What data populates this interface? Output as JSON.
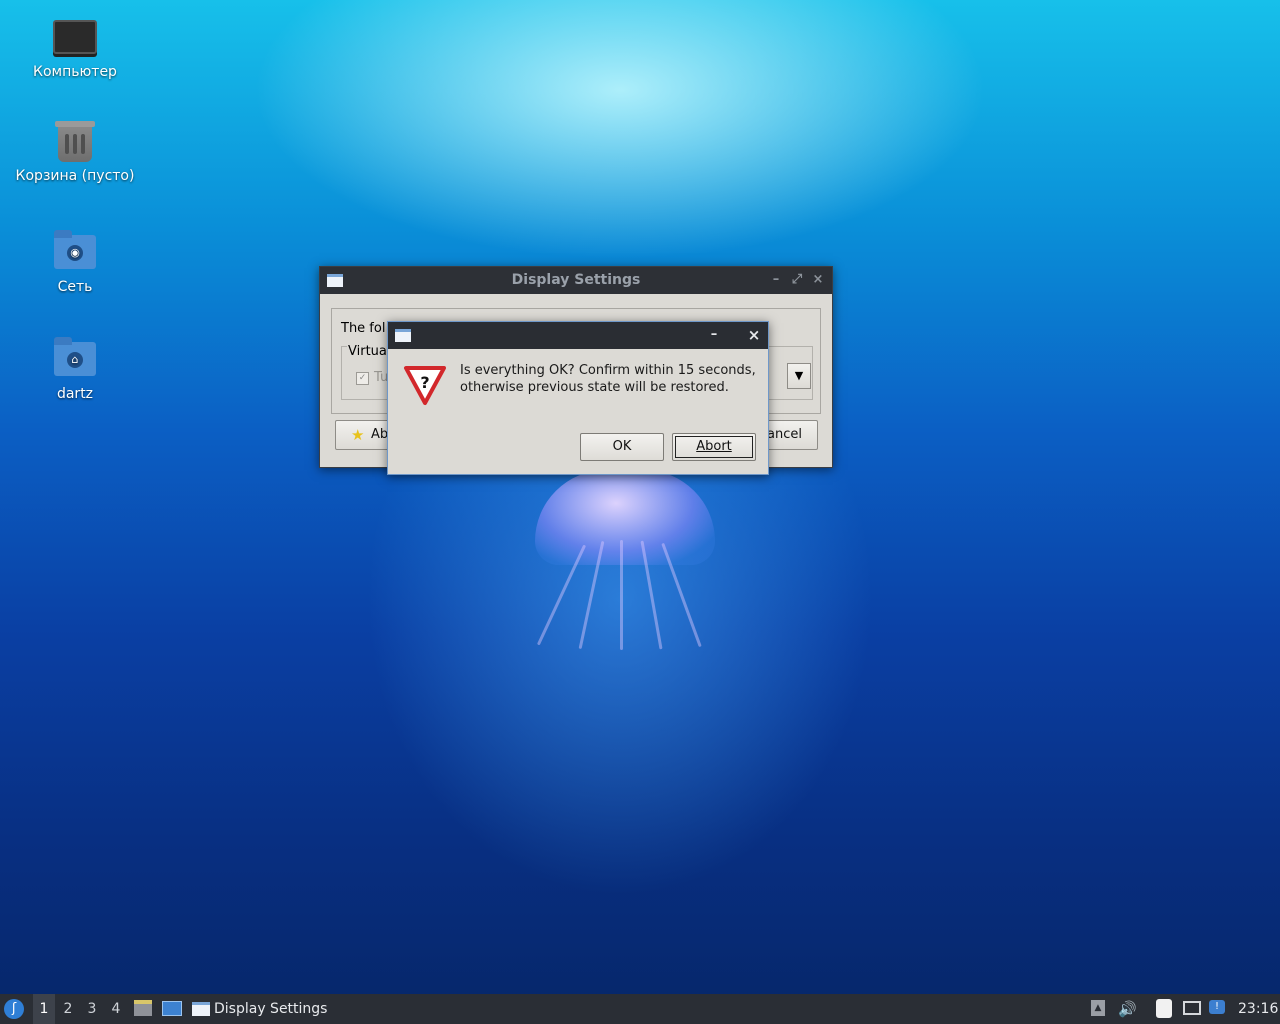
{
  "desktop": {
    "icons": [
      {
        "label": "Компьютер"
      },
      {
        "label": "Корзина (пусто)"
      },
      {
        "label": "Сеть"
      },
      {
        "label": "dartz"
      }
    ]
  },
  "main_window": {
    "title": "Display Settings",
    "body_text": "The fol",
    "group_label": "Virtua",
    "checkbox_label": "Tu",
    "about_button": "Ab",
    "cancel_button": "ancel"
  },
  "confirm_dialog": {
    "minimize_glyph": "–",
    "close_glyph": "×",
    "message_line1": "Is everything OK? Confirm within 15 seconds,",
    "message_line2": "otherwise previous state will be restored.",
    "ok_label": "OK",
    "abort_label": "Abort"
  },
  "taskbar": {
    "workspaces": [
      "1",
      "2",
      "3",
      "4"
    ],
    "active_workspace": "1",
    "window_button": "Display Settings",
    "clock": "23:16"
  },
  "colors": {
    "accent": "#6e97c9",
    "taskbar": "#2a2e35",
    "titlebar": "#2d3036"
  }
}
